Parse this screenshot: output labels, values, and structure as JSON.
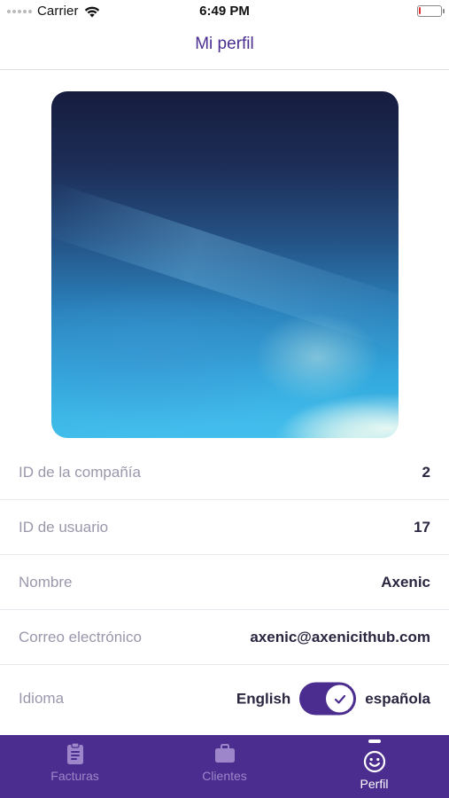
{
  "status_bar": {
    "carrier": "Carrier",
    "time": "6:49 PM",
    "battery_level": 0.1,
    "battery_color": "#e0312d"
  },
  "nav": {
    "title": "Mi perfil"
  },
  "profile": {
    "image_icon": "profile-photo"
  },
  "info": {
    "rows": [
      {
        "label": "ID de la compañía",
        "value": "2"
      },
      {
        "label": "ID de usuario",
        "value": "17"
      },
      {
        "label": "Nombre",
        "value": "Axenic"
      },
      {
        "label": "Correo electrónico",
        "value": "axenic@axenicithub.com"
      }
    ],
    "language": {
      "label": "Idioma",
      "option_left": "English",
      "option_right": "española",
      "toggle_on": true
    }
  },
  "tab_bar": {
    "tabs": [
      {
        "label": "Facturas",
        "icon": "clipboard-icon",
        "active": false
      },
      {
        "label": "Clientes",
        "icon": "briefcase-icon",
        "active": false
      },
      {
        "label": "Perfil",
        "icon": "smiley-icon",
        "active": true
      }
    ]
  },
  "colors": {
    "accent": "#4b2d8f",
    "tab_inactive": "#9d86c9",
    "label_gray": "#9b97ab",
    "value_dark": "#2b2540"
  }
}
